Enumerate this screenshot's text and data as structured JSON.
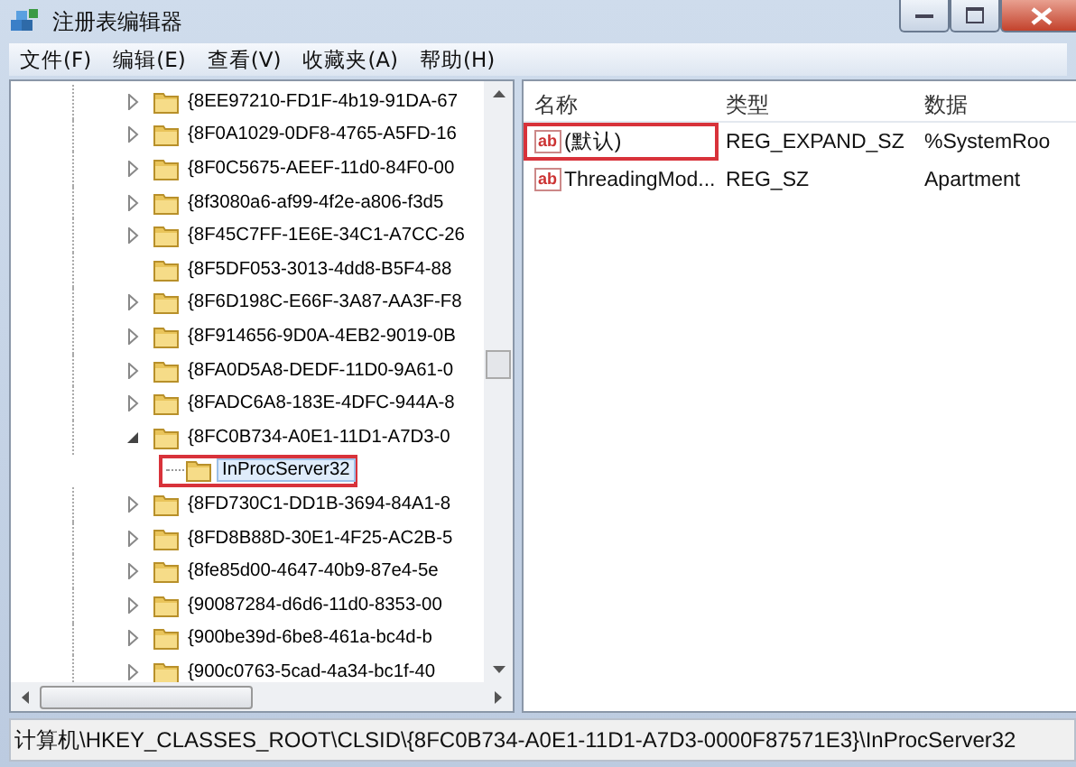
{
  "window": {
    "title": "注册表编辑器"
  },
  "menu": [
    "文件(F)",
    "编辑(E)",
    "查看(V)",
    "收藏夹(A)",
    "帮助(H)"
  ],
  "tree": [
    {
      "label": "{8EE97210-FD1F-4b19-91DA-67",
      "kind": "collapsed",
      "selected": false
    },
    {
      "label": "{8F0A1029-0DF8-4765-A5FD-16",
      "kind": "collapsed",
      "selected": false
    },
    {
      "label": "{8F0C5675-AEEF-11d0-84F0-00",
      "kind": "collapsed",
      "selected": false
    },
    {
      "label": "{8f3080a6-af99-4f2e-a806-f3d5",
      "kind": "collapsed",
      "selected": false
    },
    {
      "label": "{8F45C7FF-1E6E-34C1-A7CC-26",
      "kind": "collapsed",
      "selected": false
    },
    {
      "label": "{8F5DF053-3013-4dd8-B5F4-88",
      "kind": "leaf",
      "selected": false
    },
    {
      "label": "{8F6D198C-E66F-3A87-AA3F-F8",
      "kind": "collapsed",
      "selected": false
    },
    {
      "label": "{8F914656-9D0A-4EB2-9019-0B",
      "kind": "collapsed",
      "selected": false
    },
    {
      "label": "{8FA0D5A8-DEDF-11D0-9A61-0",
      "kind": "collapsed",
      "selected": false
    },
    {
      "label": "{8FADC6A8-183E-4DFC-944A-8",
      "kind": "collapsed",
      "selected": false
    },
    {
      "label": "{8FC0B734-A0E1-11D1-A7D3-0",
      "kind": "expanded",
      "selected": false,
      "children": [
        {
          "label": "InProcServer32",
          "kind": "leaf",
          "selected": true,
          "highlighted": true
        }
      ]
    },
    {
      "label": "{8FD730C1-DD1B-3694-84A1-8",
      "kind": "collapsed",
      "selected": false
    },
    {
      "label": "{8FD8B88D-30E1-4F25-AC2B-5",
      "kind": "collapsed",
      "selected": false
    },
    {
      "label": "{8fe85d00-4647-40b9-87e4-5e",
      "kind": "collapsed",
      "selected": false
    },
    {
      "label": "{90087284-d6d6-11d0-8353-00",
      "kind": "collapsed",
      "selected": false
    },
    {
      "label": "{900be39d-6be8-461a-bc4d-b",
      "kind": "collapsed",
      "selected": false
    },
    {
      "label": "{900c0763-5cad-4a34-bc1f-40",
      "kind": "collapsed",
      "selected": false
    }
  ],
  "values": {
    "columns": [
      "名称",
      "类型",
      "数据"
    ],
    "rows": [
      {
        "icon_text": "ab",
        "name": "(默认)",
        "type": "REG_EXPAND_SZ",
        "data": "%SystemRoo",
        "highlighted": true
      },
      {
        "icon_text": "ab",
        "name": "ThreadingMod...",
        "type": "REG_SZ",
        "data": "Apartment",
        "highlighted": false
      }
    ]
  },
  "status_bar": "计算机\\HKEY_CLASSES_ROOT\\CLSID\\{8FC0B734-A0E1-11D1-A7D3-0000F87571E3}\\InProcServer32"
}
